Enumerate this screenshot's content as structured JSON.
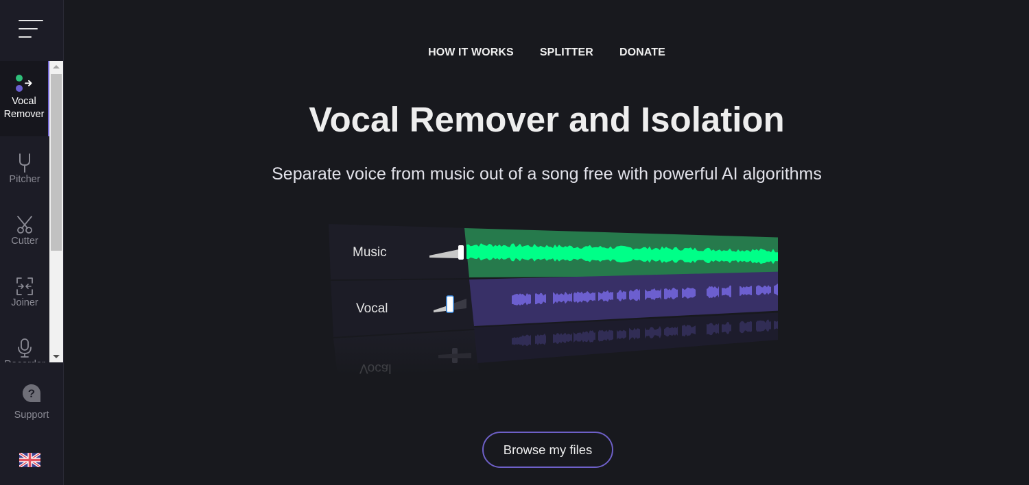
{
  "sidebar": {
    "menu_icon": "hamburger-menu-icon",
    "tools": [
      {
        "label_line1": "Vocal",
        "label_line2": "Remover",
        "icon": "vocal-remover-icon",
        "active": true
      },
      {
        "label": "Pitcher",
        "icon": "tuning-fork-icon",
        "active": false
      },
      {
        "label": "Cutter",
        "icon": "scissors-icon",
        "active": false
      },
      {
        "label": "Joiner",
        "icon": "joiner-icon",
        "active": false
      },
      {
        "label": "Recorder",
        "icon": "microphone-icon",
        "active": false
      }
    ],
    "support": {
      "label": "Support",
      "icon": "question-bubble-icon"
    },
    "language": {
      "icon": "uk-flag-icon"
    }
  },
  "nav": {
    "items": [
      "HOW IT WORKS",
      "SPLITTER",
      "DONATE"
    ]
  },
  "hero": {
    "title": "Vocal Remover and Isolation",
    "subtitle": "Separate voice from music out of a song free with powerful AI algorithms"
  },
  "illustration": {
    "tracks": [
      {
        "label": "Music",
        "volume": 1.0,
        "color": "#00ff88",
        "bg": "#267a4c"
      },
      {
        "label": "Vocal",
        "volume": 0.45,
        "color": "#6c5fcf",
        "bg": "#383067"
      }
    ],
    "reflection_label": "Vocal"
  },
  "cta": {
    "browse_label": "Browse my files"
  },
  "colors": {
    "accent": "#7467d4",
    "background": "#18191e",
    "sidebar": "#1c1c26"
  }
}
